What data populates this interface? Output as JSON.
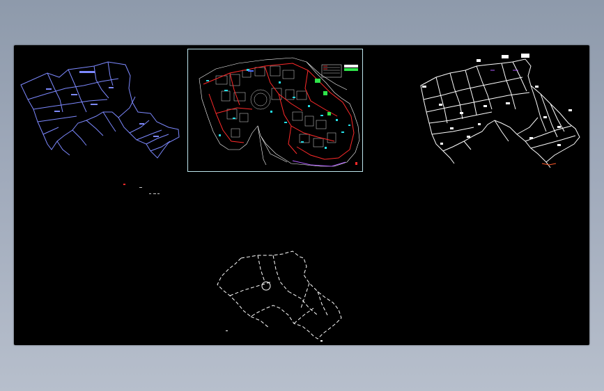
{
  "drawing": {
    "background_color": "#000000",
    "workspace_color": "#9aa5b5",
    "layer_colors": {
      "pipe_blue": "#7d89ff",
      "pipe_white": "#ffffff",
      "pipe_red": "#ff2a2a",
      "pipe_cyan": "#25e0e8",
      "boundary_green": "#2fe34a",
      "accent_purple": "#b05cff"
    },
    "panels": [
      {
        "name": "blue-pipe-network-plan",
        "icon": "network-plan-icon"
      },
      {
        "name": "site-master-plan",
        "icon": "site-plan-icon"
      },
      {
        "name": "white-pipe-network-plan",
        "icon": "network-plan-icon"
      },
      {
        "name": "lower-outline-plan",
        "icon": "outline-plan-icon"
      }
    ]
  }
}
